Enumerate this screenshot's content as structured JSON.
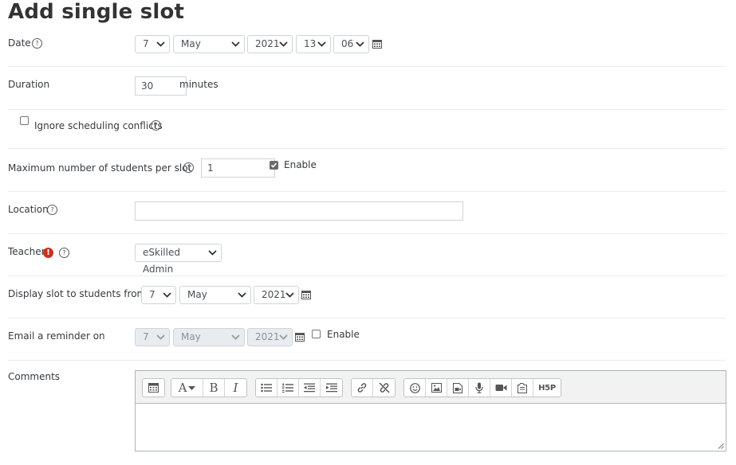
{
  "page_title": "Add single slot",
  "date": {
    "label": "Date",
    "day": "7",
    "month": "May",
    "year": "2021",
    "hour": "13",
    "minute": "06"
  },
  "duration": {
    "label": "Duration",
    "value": "30",
    "unit": "minutes"
  },
  "ignore_conflicts": {
    "label": "Ignore scheduling conflicts",
    "checked": false
  },
  "max_students": {
    "label": "Maximum number of students per slot",
    "value": "1",
    "enable_label": "Enable",
    "enabled": true
  },
  "location": {
    "label": "Location",
    "value": ""
  },
  "teacher": {
    "label": "Teacher",
    "value": "eSkilled Admin"
  },
  "display_from": {
    "label": "Display slot to students from",
    "day": "7",
    "month": "May",
    "year": "2021"
  },
  "reminder": {
    "label": "Email a reminder on",
    "day": "7",
    "month": "May",
    "year": "2021",
    "enable_label": "Enable",
    "enabled": false
  },
  "comments": {
    "label": "Comments",
    "value": ""
  },
  "editor_toolbar": {
    "groups": [
      [
        "toolbar-toggle-icon"
      ],
      [
        "font-style-icon",
        "bold-icon",
        "italic-icon"
      ],
      [
        "unordered-list-icon",
        "ordered-list-icon",
        "outdent-icon",
        "indent-icon"
      ],
      [
        "link-icon",
        "unlink-icon"
      ],
      [
        "emoji-icon",
        "image-icon",
        "media-icon",
        "record-audio-icon",
        "record-video-icon",
        "manage-files-icon",
        "h5p-icon"
      ]
    ],
    "bold_glyph": "B",
    "italic_glyph": "I",
    "font_glyph": "A",
    "h5p_glyph": "H5P"
  }
}
